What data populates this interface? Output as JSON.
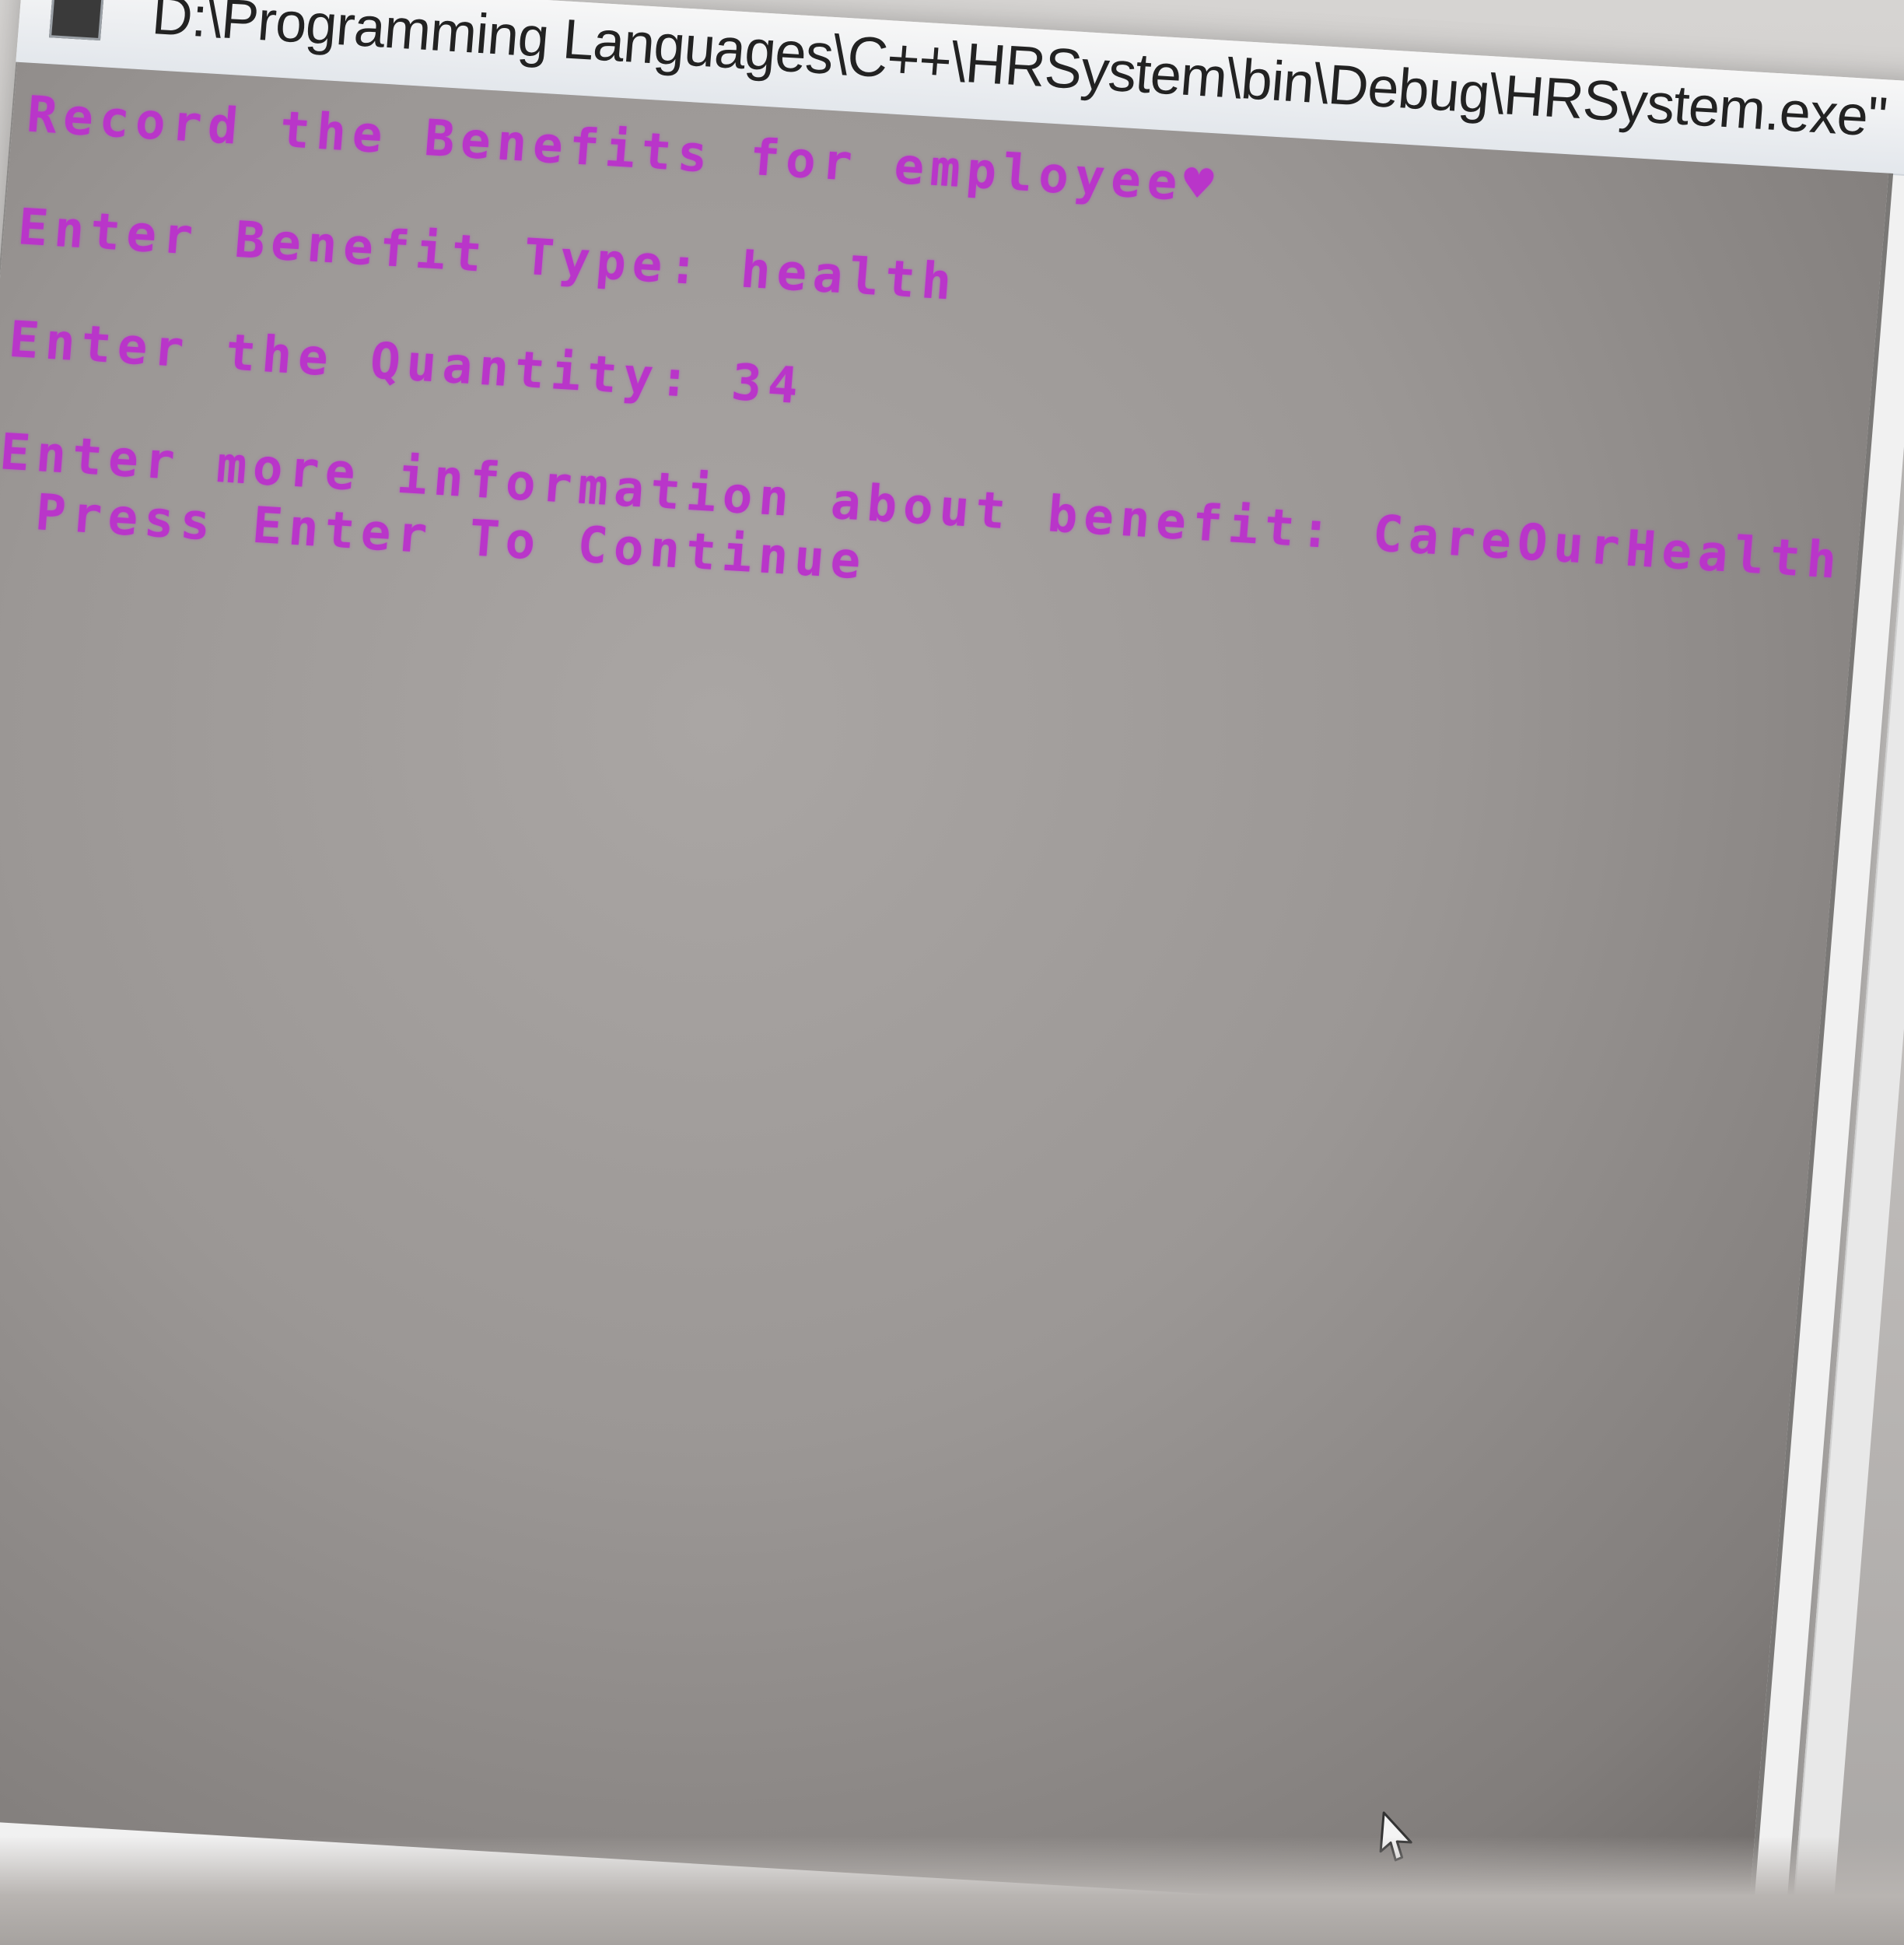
{
  "window": {
    "title": "D:\\Programming Languages\\C++\\HRSystem\\bin\\Debug\\HRSystem.exe\""
  },
  "console": {
    "text_color": "#b935c9",
    "background_color": "#9b9795",
    "lines": [
      "Record the Benefits for employee♥",
      "Enter Benefit Type: health",
      "Enter the Quantity: 34",
      "Enter more information about benefit: CareOurHealth",
      "Press Enter To Continue"
    ]
  },
  "icons": {
    "app": "console-app-icon",
    "cursor": "mouse-pointer-icon"
  }
}
